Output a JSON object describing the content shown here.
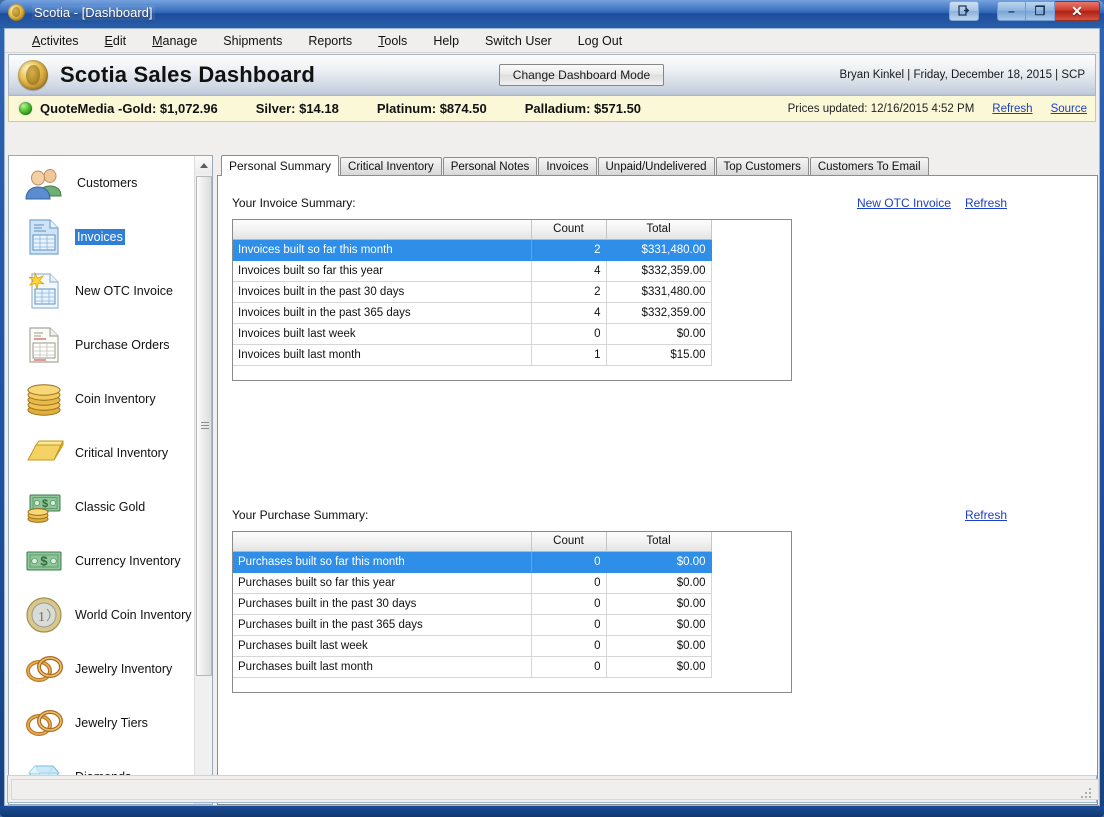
{
  "window": {
    "title": "Scotia - [Dashboard]",
    "icon": "coin-icon",
    "buttons": {
      "restore_doc": "restore-document-icon",
      "minimize": "–",
      "maximize": "❐",
      "close": "✕"
    }
  },
  "menubar": {
    "items": [
      {
        "label": "Activites",
        "accel": "A"
      },
      {
        "label": "Edit",
        "accel": "E"
      },
      {
        "label": "Manage",
        "accel": "M"
      },
      {
        "label": "Shipments",
        "accel": ""
      },
      {
        "label": "Reports",
        "accel": ""
      },
      {
        "label": "Tools",
        "accel": "T"
      },
      {
        "label": "Help",
        "accel": ""
      },
      {
        "label": "Switch User",
        "accel": ""
      },
      {
        "label": "Log Out",
        "accel": ""
      }
    ]
  },
  "banner": {
    "logo": "gold-coin-logo",
    "title": "Scotia Sales Dashboard",
    "mode_button": "Change Dashboard Mode",
    "user_info": "Bryan Kinkel | Friday, December 18, 2015 | SCP"
  },
  "ticker": {
    "status_led": "green-status-led",
    "source_label": "QuoteMedia - ",
    "gold": "Gold: $1,072.96",
    "silver": "Silver: $14.18",
    "platinum": "Platinum: $874.50",
    "palladium": "Palladium: $571.50",
    "prices_updated": "Prices updated: 12/16/2015 4:52 PM",
    "refresh_link": "Refresh",
    "source_link": "Source",
    "link_color": "#1d3fc4",
    "background": "#fbf8d8"
  },
  "sidebar": {
    "items": [
      {
        "label": "Customers",
        "icon": "customers-icon",
        "selected": false
      },
      {
        "label": "Invoices",
        "icon": "invoice-document-icon",
        "selected": true
      },
      {
        "label": "New OTC Invoice",
        "icon": "new-invoice-icon",
        "selected": false
      },
      {
        "label": "Purchase Orders",
        "icon": "purchase-order-icon",
        "selected": false
      },
      {
        "label": "Coin Inventory",
        "icon": "coin-stack-icon",
        "selected": false
      },
      {
        "label": "Critical Inventory",
        "icon": "gold-bar-icon",
        "selected": false
      },
      {
        "label": "Classic Gold",
        "icon": "cash-and-coins-icon",
        "selected": false
      },
      {
        "label": "Currency Inventory",
        "icon": "banknote-icon",
        "selected": false
      },
      {
        "label": "World Coin Inventory",
        "icon": "euro-coin-icon",
        "selected": false
      },
      {
        "label": "Jewelry Inventory",
        "icon": "rings-icon",
        "selected": false
      },
      {
        "label": "Jewelry Tiers",
        "icon": "rings-icon",
        "selected": false
      },
      {
        "label": "Diamonds",
        "icon": "diamond-icon",
        "selected": false
      }
    ],
    "scroll": {
      "up_arrow": "▲",
      "down_arrow": "▼"
    },
    "selection_color": "#2f7fd6"
  },
  "tabs": [
    {
      "label": "Personal Summary",
      "active": true
    },
    {
      "label": "Critical Inventory",
      "active": false
    },
    {
      "label": "Personal Notes",
      "active": false
    },
    {
      "label": "Invoices",
      "active": false
    },
    {
      "label": "Unpaid/Undelivered",
      "active": false
    },
    {
      "label": "Top Customers",
      "active": false
    },
    {
      "label": "Customers To Email",
      "active": false
    }
  ],
  "invoice_summary": {
    "heading": "Your Invoice Summary:",
    "links": [
      {
        "label": "New OTC Invoice"
      },
      {
        "label": "Refresh"
      }
    ],
    "columns": [
      "",
      "Count",
      "Total"
    ],
    "rows": [
      {
        "label": "Invoices built so far this month",
        "count": "2",
        "total": "$331,480.00",
        "selected": true
      },
      {
        "label": "Invoices built so far this year",
        "count": "4",
        "total": "$332,359.00",
        "selected": false
      },
      {
        "label": "Invoices built in the past 30 days",
        "count": "2",
        "total": "$331,480.00",
        "selected": false
      },
      {
        "label": "Invoices built in the past 365 days",
        "count": "4",
        "total": "$332,359.00",
        "selected": false
      },
      {
        "label": "Invoices built last week",
        "count": "0",
        "total": "$0.00",
        "selected": false
      },
      {
        "label": "Invoices built last month",
        "count": "1",
        "total": "$15.00",
        "selected": false
      }
    ]
  },
  "purchase_summary": {
    "heading": "Your Purchase Summary:",
    "links": [
      {
        "label": "Refresh"
      }
    ],
    "columns": [
      "",
      "Count",
      "Total"
    ],
    "rows": [
      {
        "label": "Purchases built so far this month",
        "count": "0",
        "total": "$0.00",
        "selected": true
      },
      {
        "label": "Purchases built so far this year",
        "count": "0",
        "total": "$0.00",
        "selected": false
      },
      {
        "label": "Purchases built in the past 30 days",
        "count": "0",
        "total": "$0.00",
        "selected": false
      },
      {
        "label": "Purchases built in the past 365 days",
        "count": "0",
        "total": "$0.00",
        "selected": false
      },
      {
        "label": "Purchases built last week",
        "count": "0",
        "total": "$0.00",
        "selected": false
      },
      {
        "label": "Purchases built last month",
        "count": "0",
        "total": "$0.00",
        "selected": false
      }
    ]
  },
  "statusbar": {
    "text": ""
  },
  "theme": {
    "row_selection": "#2f8ee8",
    "window_chrome": "#1f4f9e",
    "ticker_bg": "#fbf8d8"
  }
}
